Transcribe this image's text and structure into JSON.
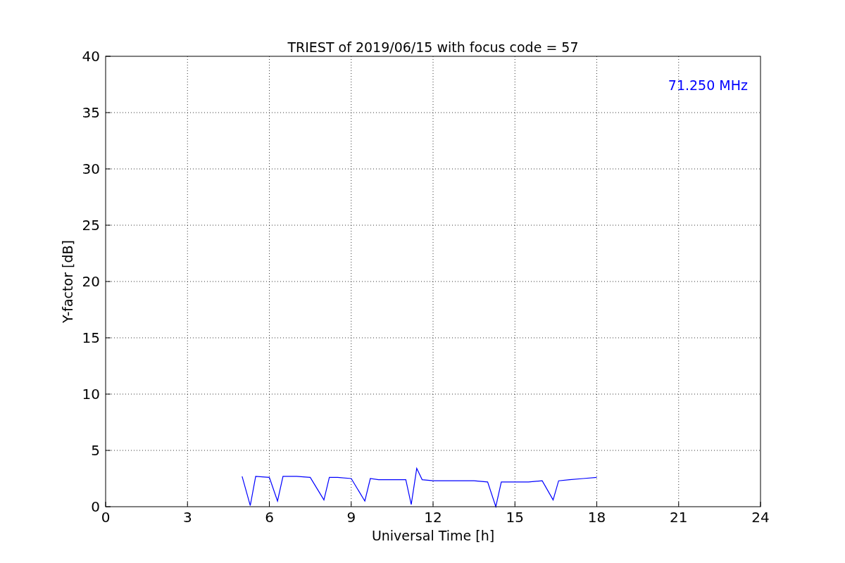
{
  "chart_data": {
    "type": "line",
    "title": "TRIEST of 2019/06/15 with focus code = 57",
    "xlabel": "Universal Time [h]",
    "ylabel": "Y-factor [dB]",
    "x": [
      5,
      5.3,
      5.5,
      6,
      6.3,
      6.5,
      7,
      7.5,
      8,
      8.2,
      8.5,
      9,
      9.5,
      9.7,
      10,
      10.5,
      11,
      11.2,
      11.4,
      11.6,
      12,
      12.5,
      13,
      13.5,
      14,
      14.3,
      14.5,
      15,
      15.5,
      16,
      16.4,
      16.6,
      17,
      17.5,
      18
    ],
    "series": [
      {
        "name": "71.250 MHz",
        "color": "#0000ff",
        "values": [
          2.7,
          0.1,
          2.7,
          2.6,
          0.5,
          2.7,
          2.7,
          2.6,
          0.6,
          2.6,
          2.6,
          2.5,
          0.5,
          2.5,
          2.4,
          2.4,
          2.4,
          0.2,
          3.4,
          2.4,
          2.3,
          2.3,
          2.3,
          2.3,
          2.2,
          0,
          2.2,
          2.2,
          2.2,
          2.3,
          0.6,
          2.3,
          2.4,
          2.5,
          2.6
        ]
      }
    ],
    "xlim": [
      0,
      24
    ],
    "ylim": [
      0,
      40
    ],
    "xticks": [
      0,
      3,
      6,
      9,
      12,
      15,
      18,
      21,
      24
    ],
    "yticks": [
      0,
      5,
      10,
      15,
      20,
      25,
      30,
      35,
      40
    ],
    "grid": true
  }
}
